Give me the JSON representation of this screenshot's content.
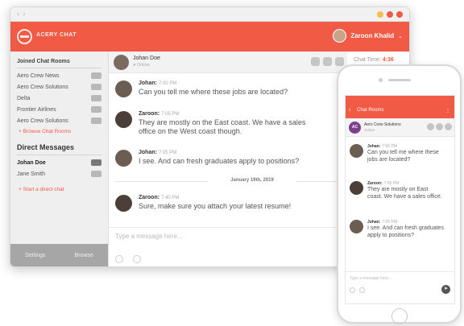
{
  "colors": {
    "accent": "#f15a45",
    "titlebar_dots": [
      "#f5bf4f",
      "#f15a45",
      "#f15a45"
    ]
  },
  "titlebar": {
    "nav_arrows": "‹ ›"
  },
  "appbar": {
    "app_name": "ACERY CHAT",
    "user_name": "Zaroon Khalid",
    "user_menu_icon": "chevron-down-icon"
  },
  "sidebar": {
    "joined_heading": "Joined Chat Rooms",
    "rooms": [
      {
        "label": "Aero Crew News"
      },
      {
        "label": "Aero Crew Solutions"
      },
      {
        "label": "Delta"
      },
      {
        "label": "Frontier Airlines"
      },
      {
        "label": "Aero Crew Solutions"
      }
    ],
    "browse_link": "+ Browse Chat Rooms",
    "dm_heading": "Direct Messages",
    "dms": [
      {
        "label": "Johan Doe"
      },
      {
        "label": "Jane Smith"
      }
    ],
    "new_dm_link": "+ Start a direct chat",
    "footer": {
      "settings": "Settings",
      "browse": "Browse"
    }
  },
  "chat": {
    "contact_name": "Johan Doe",
    "contact_status": "● Online",
    "timer_label": "Chat Time:",
    "timer_value": "4:36",
    "messages": [
      {
        "author": "Johan:",
        "time": "7:00 PM",
        "text": "Can you tell me where these jobs are located?"
      },
      {
        "author": "Zaroon:",
        "time": "7:05 PM",
        "text": "They are mostly on the East coast. We have a sales office on the West coast though."
      },
      {
        "author": "Johan:",
        "time": "7:05 PM",
        "text": "I see. And can fresh graduates apply to positions?"
      },
      {
        "author": "Zaroon:",
        "time": "7:40 PM",
        "text": "Sure, make sure you attach your latest resume!"
      }
    ],
    "day_separator": "January 19th, 2019",
    "composer_placeholder": "Type a message here...",
    "send_icon": "send-icon"
  },
  "phone": {
    "screen_title": "Chat Rooms",
    "room": {
      "initials": "AC",
      "name": "Aero Crew Solutions",
      "sub": "Online"
    },
    "messages": [
      {
        "author": "Johan:",
        "time": "7:00 PM",
        "text": "Can you tell me where these jobs are located?"
      },
      {
        "author": "Zaroon:",
        "time": "7:05 PM",
        "text": "They are mostly on East coast. We have a sales office."
      },
      {
        "author": "Johan:",
        "time": "7:05 PM",
        "text": "I see. And can fresh graduates apply to positions?"
      }
    ],
    "composer_placeholder": "Type a message here..."
  }
}
